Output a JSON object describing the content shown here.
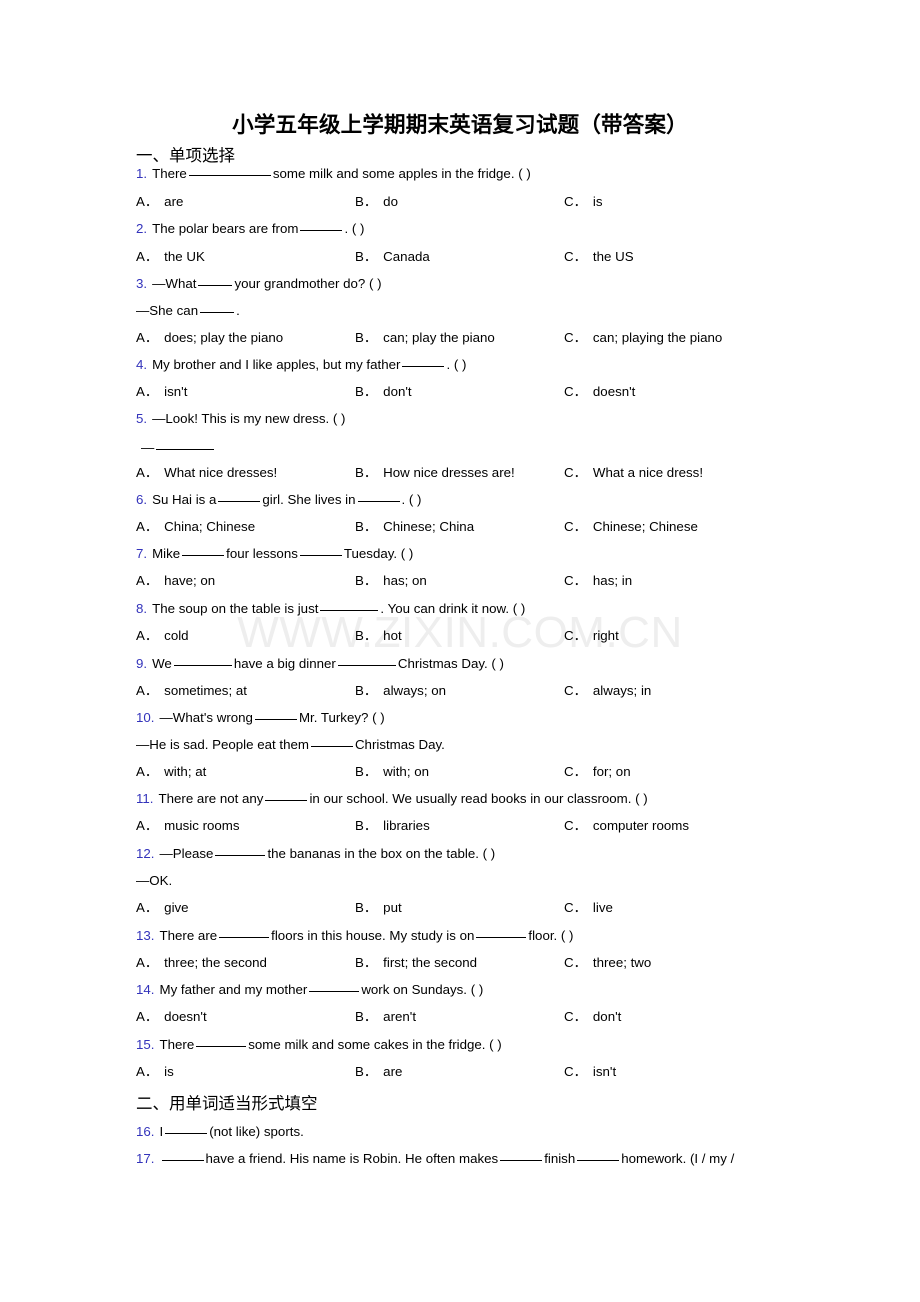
{
  "document": {
    "title": "小学五年级上学期期末英语复习试题（带答案）",
    "watermark": "WWW.ZIXIN.COM.CN",
    "accent_color": "#3333bb",
    "text_color": "#000000",
    "watermark_color": "#eeeeee",
    "background_color": "#ffffff"
  },
  "sections": [
    {
      "id": "sec1",
      "heading": "一、单项选择"
    },
    {
      "id": "sec2",
      "heading": "二、用单词适当形式填空"
    }
  ],
  "questions": [
    {
      "num": "1.",
      "stem_parts": [
        "There",
        "some milk and some apples in the fridge. (   )"
      ],
      "options": [
        {
          "label": "A．",
          "text": "are"
        },
        {
          "label": "B．",
          "text": "do"
        },
        {
          "label": "C．",
          "text": "is"
        }
      ]
    },
    {
      "num": "2.",
      "stem_parts": [
        "The polar bears are from",
        ". (   )"
      ],
      "options": [
        {
          "label": "A．",
          "text": "the UK"
        },
        {
          "label": "B．",
          "text": "Canada"
        },
        {
          "label": "C．",
          "text": "the US"
        }
      ]
    },
    {
      "num": "3.",
      "stem_parts": [
        "—What",
        "your grandmother do? (   )"
      ],
      "stem_line2_parts": [
        "—She can",
        "."
      ],
      "options": [
        {
          "label": "A．",
          "text": "does; play the piano"
        },
        {
          "label": "B．",
          "text": "can; play the piano"
        },
        {
          "label": "C．",
          "text": "can; playing the piano"
        }
      ]
    },
    {
      "num": "4.",
      "stem_parts": [
        "My brother and I like apples, but my father",
        ". (   )"
      ],
      "options": [
        {
          "label": "A．",
          "text": "isn't"
        },
        {
          "label": "B．",
          "text": "don't"
        },
        {
          "label": "C．",
          "text": "doesn't"
        }
      ]
    },
    {
      "num": "5.",
      "stem_parts": [
        "—Look! This is my new dress. (   )"
      ],
      "stem_line2_parts": [
        "—"
      ],
      "options": [
        {
          "label": "A．",
          "text": "What nice dresses!"
        },
        {
          "label": "B．",
          "text": "How nice dresses are!"
        },
        {
          "label": "C．",
          "text": "What a nice dress!"
        }
      ]
    },
    {
      "num": "6.",
      "stem_parts": [
        "Su Hai is a",
        "girl. She lives in",
        ". (   )"
      ],
      "options": [
        {
          "label": "A．",
          "text": "China; Chinese"
        },
        {
          "label": "B．",
          "text": "Chinese; China"
        },
        {
          "label": "C．",
          "text": "Chinese; Chinese"
        }
      ]
    },
    {
      "num": "7.",
      "stem_parts": [
        "Mike",
        "four lessons",
        "Tuesday. (   )"
      ],
      "options": [
        {
          "label": "A．",
          "text": "have; on"
        },
        {
          "label": "B．",
          "text": "has; on"
        },
        {
          "label": "C．",
          "text": "has; in"
        }
      ]
    },
    {
      "num": "8.",
      "stem_parts": [
        "The soup on the table is just",
        ". You can drink it now. (   )"
      ],
      "options": [
        {
          "label": "A．",
          "text": "cold"
        },
        {
          "label": "B．",
          "text": "hot"
        },
        {
          "label": "C．",
          "text": "right"
        }
      ]
    },
    {
      "num": "9.",
      "stem_parts": [
        "We",
        "have a big dinner",
        "Christmas Day. (   )"
      ],
      "options": [
        {
          "label": "A．",
          "text": "sometimes; at"
        },
        {
          "label": "B．",
          "text": "always; on"
        },
        {
          "label": "C．",
          "text": "always; in"
        }
      ]
    },
    {
      "num": "10.",
      "stem_parts": [
        "—What's wrong",
        "Mr. Turkey? (   )"
      ],
      "stem_line2_parts": [
        "—He is sad. People eat them",
        "Christmas Day."
      ],
      "options": [
        {
          "label": "A．",
          "text": "with; at"
        },
        {
          "label": "B．",
          "text": "with; on"
        },
        {
          "label": "C．",
          "text": "for; on"
        }
      ]
    },
    {
      "num": "11.",
      "stem_parts": [
        "There are not any",
        "in our school. We usually read books in our classroom. (   )"
      ],
      "options": [
        {
          "label": "A．",
          "text": "music rooms"
        },
        {
          "label": "B．",
          "text": "libraries"
        },
        {
          "label": "C．",
          "text": "computer rooms"
        }
      ]
    },
    {
      "num": "12.",
      "stem_parts": [
        "—Please",
        "the bananas in the box on the table. (   )"
      ],
      "stem_line2_parts": [
        "—OK."
      ],
      "options": [
        {
          "label": "A．",
          "text": "give"
        },
        {
          "label": "B．",
          "text": "put"
        },
        {
          "label": "C．",
          "text": "live"
        }
      ]
    },
    {
      "num": "13.",
      "stem_parts": [
        "There are",
        "floors in this house. My study is on",
        "floor. (   )"
      ],
      "options": [
        {
          "label": "A．",
          "text": "three; the second"
        },
        {
          "label": "B．",
          "text": "first; the second"
        },
        {
          "label": "C．",
          "text": "three; two"
        }
      ]
    },
    {
      "num": "14.",
      "stem_parts": [
        "My father and my mother",
        "work on Sundays. (   )"
      ],
      "options": [
        {
          "label": "A．",
          "text": "doesn't"
        },
        {
          "label": "B．",
          "text": "aren't"
        },
        {
          "label": "C．",
          "text": "don't"
        }
      ]
    },
    {
      "num": "15.",
      "stem_parts": [
        "There",
        "some milk and some cakes in the fridge. (   )"
      ],
      "options": [
        {
          "label": "A．",
          "text": "is"
        },
        {
          "label": "B．",
          "text": "are"
        },
        {
          "label": "C．",
          "text": "isn't"
        }
      ]
    },
    {
      "num": "16.",
      "stem_parts": [
        "I",
        "(not like) sports."
      ]
    },
    {
      "num": "17.",
      "stem_parts": [
        "",
        "have a friend. His name is Robin. He often makes",
        "finish",
        "homework. (I / my /"
      ]
    }
  ]
}
